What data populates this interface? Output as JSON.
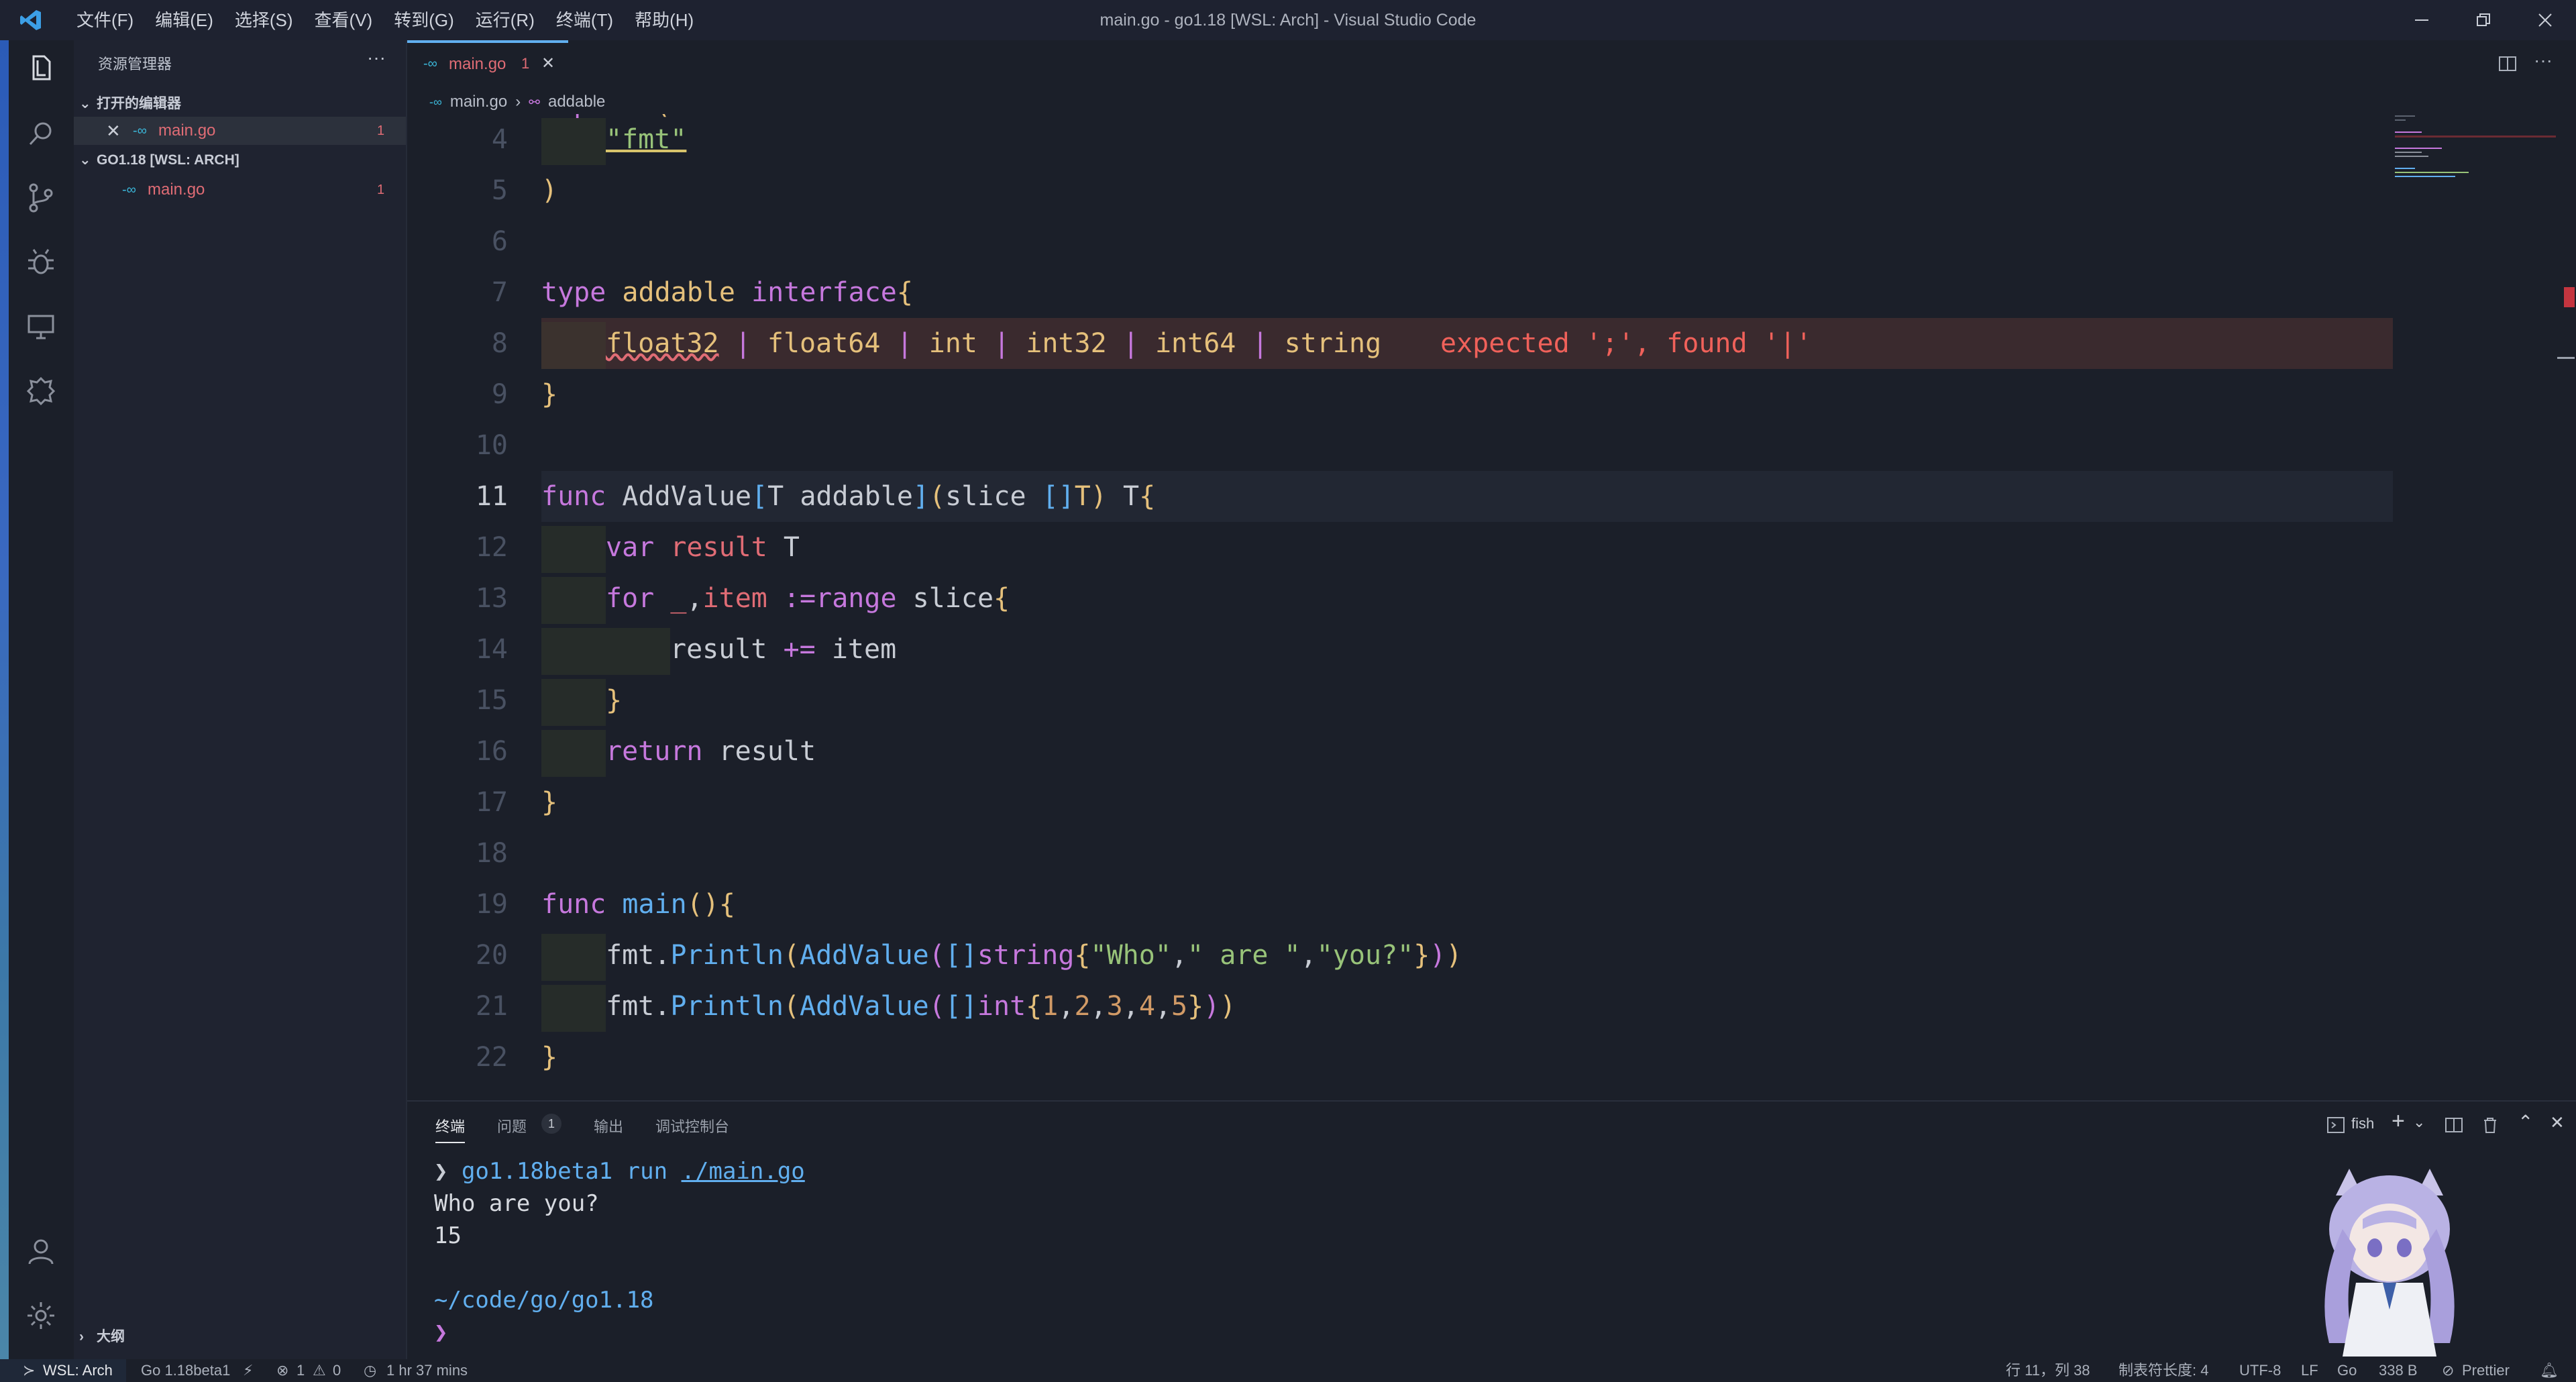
{
  "titlebar": {
    "menus": [
      "文件(F)",
      "编辑(E)",
      "选择(S)",
      "查看(V)",
      "转到(G)",
      "运行(R)",
      "终端(T)",
      "帮助(H)"
    ],
    "title": "main.go - go1.18 [WSL: Arch] - Visual Studio Code"
  },
  "sidebar": {
    "title": "资源管理器",
    "open_editors": {
      "header": "打开的编辑器",
      "file": "main.go",
      "badge": "1"
    },
    "workspace": {
      "header": "GO1.18 [WSL: ARCH]",
      "file": "main.go",
      "badge": "1"
    },
    "outline": "大纲"
  },
  "tabs": [
    {
      "label": "main.go",
      "badge": "1"
    }
  ],
  "breadcrumb": [
    "main.go",
    "addable"
  ],
  "editor": {
    "line_numbers": [
      "4",
      "5",
      "6",
      "7",
      "8",
      "9",
      "10",
      "11",
      "12",
      "13",
      "14",
      "15",
      "16",
      "17",
      "18",
      "19",
      "20",
      "21",
      "22"
    ],
    "active_line": "11",
    "diagnostic": "expected ';', found '|'",
    "lines": {
      "l4": "\"fmt\"",
      "l8_types": [
        "float32",
        "float64",
        "int",
        "int32",
        "int64",
        "string"
      ]
    }
  },
  "panel": {
    "tabs": [
      "终端",
      "问题",
      "输出",
      "调试控制台"
    ],
    "problems_count": "1",
    "shell": "fish",
    "terminal": {
      "prompt": "❯",
      "command": "go1.18beta1",
      "run": "run",
      "arg": "./main.go",
      "out1": "Who are you?",
      "out2": "15",
      "cwd": "~/code/go/go1.18",
      "prompt2": "❯"
    }
  },
  "statusbar": {
    "remote": "WSL: Arch",
    "go_version": "Go 1.18beta1",
    "errors": "1",
    "warnings": "0",
    "time": "1 hr 37 mins",
    "position": "行 11，列 38",
    "tab_size": "制表符长度: 4",
    "encoding": "UTF-8",
    "eol": "LF",
    "language": "Go",
    "size": "338 B",
    "formatter": "Prettier"
  },
  "colors": {
    "background": "#1b1f29",
    "error": "#e06c75",
    "keyword": "#c678dd",
    "type": "#e5c07b",
    "function": "#61afef",
    "string": "#98c379",
    "number": "#d19a66"
  }
}
